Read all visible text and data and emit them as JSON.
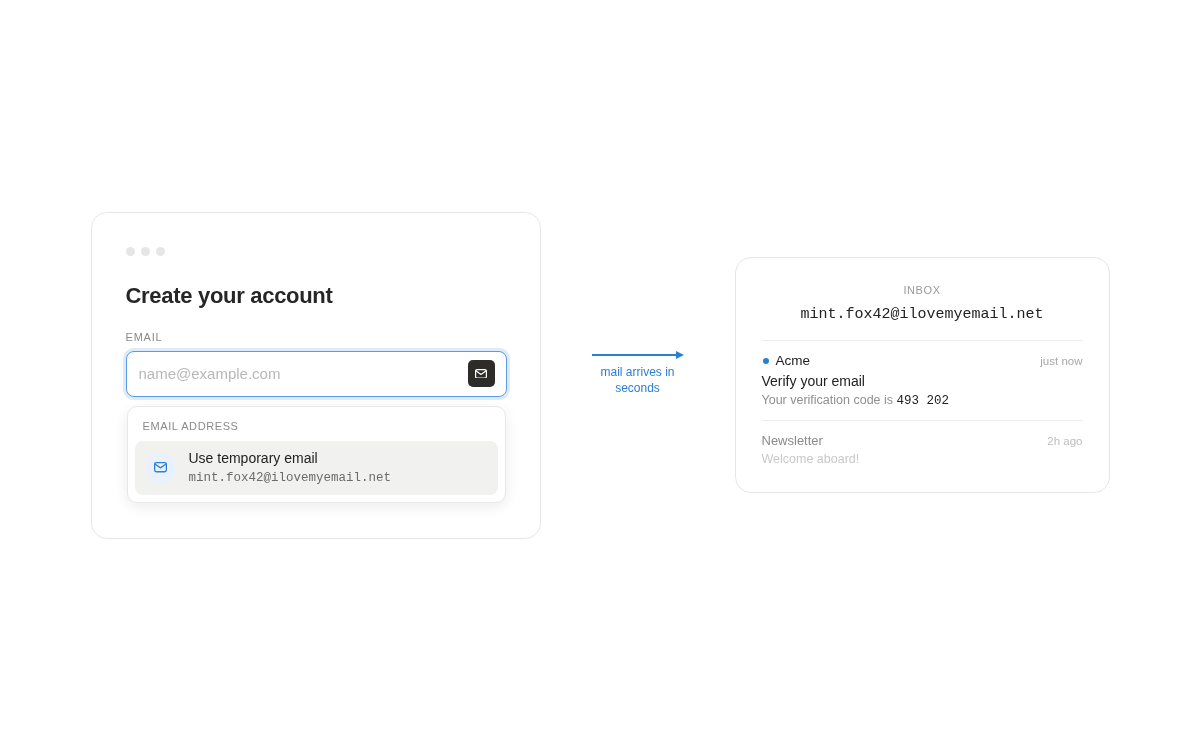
{
  "signup_card": {
    "title": "Create your account",
    "email_field": {
      "label": "EMAIL",
      "placeholder": "name@example.com",
      "focused": true
    },
    "dropdown": {
      "heading": "EMAIL ADDRESS",
      "options": [
        {
          "label": "Use temporary email",
          "value": "mint.fox42@ilovemyemail.net",
          "selected": true
        }
      ]
    }
  },
  "arrow_caption": "mail arrives in seconds",
  "inbox": {
    "heading": "INBOX",
    "address": "mint.fox42@ilovemyemail.net",
    "messages": [
      {
        "sender": "Acme",
        "time": "just now",
        "subject": "Verify your email",
        "preview": "Your verification code is",
        "code": "493 202",
        "unread": true
      },
      {
        "sender": "Newsletter",
        "time": "2h ago",
        "preview": "Welcome aboard!",
        "unread": false
      }
    ]
  }
}
